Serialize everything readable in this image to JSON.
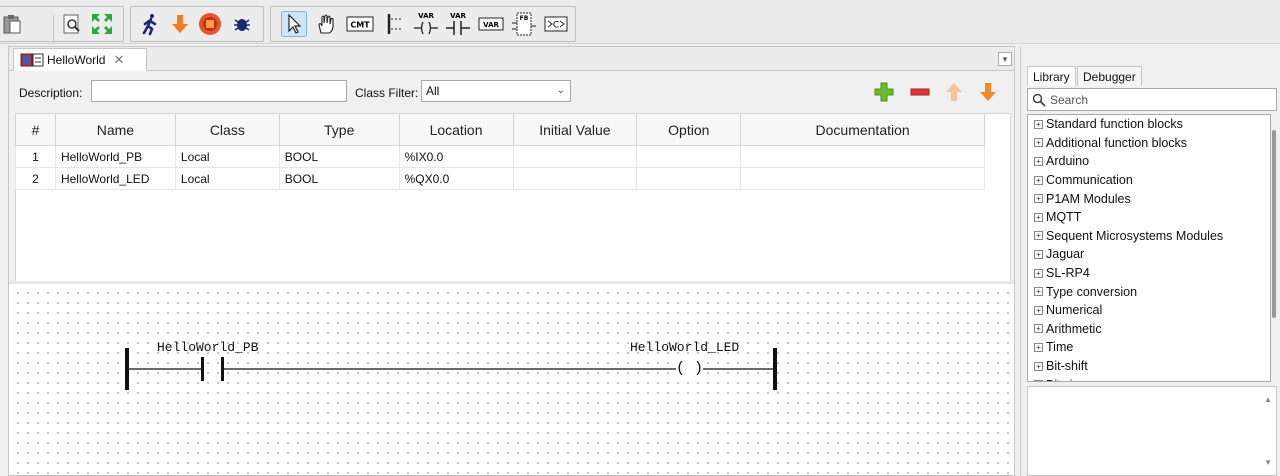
{
  "toolbar": {
    "icons": [
      "paste-icon",
      "zoom-fit-icon",
      "fullscreen-icon",
      "run-icon",
      "transfer-icon",
      "stop-icon",
      "debug-icon",
      "select-pointer-icon",
      "hand-pan-icon",
      "comment-icon",
      "power-rail-icon",
      "variable-coil-icon",
      "variable-contact-icon",
      "variable-block-icon",
      "function-block-icon",
      "connection-icon"
    ],
    "comment_label": "CMT",
    "var_label": "VAR",
    "fb_label": "FB"
  },
  "editor": {
    "tab_title": "HelloWorld",
    "tab_close": "✕",
    "description_label": "Description:",
    "description_value": "",
    "class_filter_label": "Class Filter:",
    "class_filter_value": "All",
    "columns": [
      "#",
      "Name",
      "Class",
      "Type",
      "Location",
      "Initial Value",
      "Option",
      "Documentation"
    ],
    "rows": [
      {
        "num": "1",
        "name": "HelloWorld_PB",
        "class": "Local",
        "type": "BOOL",
        "location": "%IX0.0",
        "initial": "",
        "option": "",
        "doc": ""
      },
      {
        "num": "2",
        "name": "HelloWorld_LED",
        "class": "Local",
        "type": "BOOL",
        "location": "%QX0.0",
        "initial": "",
        "option": "",
        "doc": ""
      }
    ],
    "colors": {
      "add": "#6cbb2f",
      "remove": "#e0343a",
      "arrow_up": "#f3c49b",
      "arrow_down": "#f08a2c"
    }
  },
  "ladder": {
    "contact_label": "HelloWorld_PB",
    "coil_label": "HelloWorld_LED",
    "coil_symbol": "( )"
  },
  "library": {
    "tabs": [
      "Library",
      "Debugger"
    ],
    "search_placeholder": "Search",
    "items": [
      "Standard function blocks",
      "Additional function blocks",
      "Arduino",
      "Communication",
      "P1AM Modules",
      "MQTT",
      "Sequent Microsystems Modules",
      "Jaguar",
      "SL-RP4",
      "Type conversion",
      "Numerical",
      "Arithmetic",
      "Time",
      "Bit-shift",
      "Bitwise"
    ]
  }
}
